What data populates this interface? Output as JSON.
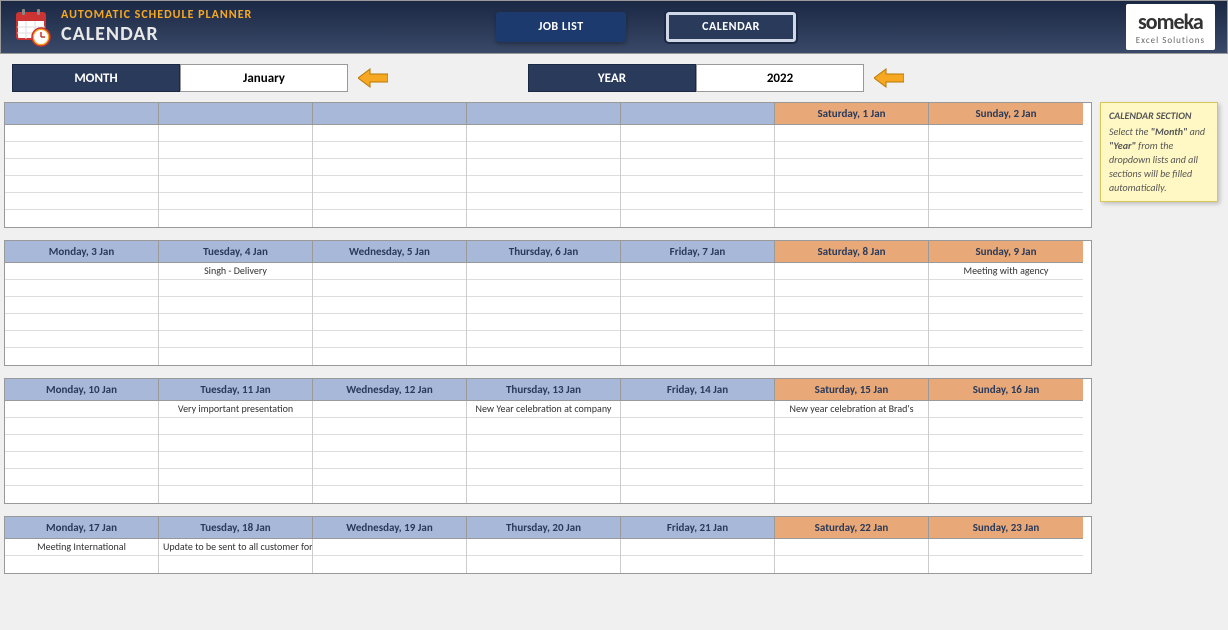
{
  "header": {
    "title_top": "AUTOMATIC SCHEDULE PLANNER",
    "title_main": "CALENDAR",
    "nav_joblist": "JOB LIST",
    "nav_calendar": "CALENDAR",
    "brand_main": "someka",
    "brand_sub": "Excel Solutions"
  },
  "controls": {
    "month_label": "MONTH",
    "month_value": "January",
    "year_label": "YEAR",
    "year_value": "2022"
  },
  "info": {
    "title": "CALENDAR SECTION",
    "text_before_month": "Select the ",
    "month_word": "\"Month\"",
    "text_mid": " and ",
    "year_word": "\"Year\"",
    "text_after": " from the dropdown lists and all sections will be filled automatically."
  },
  "weeks": [
    {
      "days": [
        {
          "label": "",
          "type": "blank",
          "events": [
            "",
            "",
            "",
            "",
            "",
            ""
          ]
        },
        {
          "label": "",
          "type": "blank",
          "events": [
            "",
            "",
            "",
            "",
            "",
            ""
          ]
        },
        {
          "label": "",
          "type": "blank",
          "events": [
            "",
            "",
            "",
            "",
            "",
            ""
          ]
        },
        {
          "label": "",
          "type": "blank",
          "events": [
            "",
            "",
            "",
            "",
            "",
            ""
          ]
        },
        {
          "label": "",
          "type": "blank",
          "events": [
            "",
            "",
            "",
            "",
            "",
            ""
          ]
        },
        {
          "label": "Saturday, 1 Jan",
          "type": "weekend",
          "events": [
            "",
            "",
            "",
            "",
            "",
            ""
          ]
        },
        {
          "label": "Sunday, 2 Jan",
          "type": "weekend",
          "events": [
            "",
            "",
            "",
            "",
            "",
            ""
          ]
        }
      ],
      "rows": 6
    },
    {
      "days": [
        {
          "label": "Monday, 3 Jan",
          "type": "weekday",
          "events": [
            "",
            "",
            "",
            "",
            "",
            ""
          ]
        },
        {
          "label": "Tuesday, 4 Jan",
          "type": "weekday",
          "events": [
            "Singh - Delivery",
            "",
            "",
            "",
            "",
            ""
          ]
        },
        {
          "label": "Wednesday, 5 Jan",
          "type": "weekday",
          "events": [
            "",
            "",
            "",
            "",
            "",
            ""
          ]
        },
        {
          "label": "Thursday, 6 Jan",
          "type": "weekday",
          "events": [
            "",
            "",
            "",
            "",
            "",
            ""
          ]
        },
        {
          "label": "Friday, 7 Jan",
          "type": "weekday",
          "events": [
            "",
            "",
            "",
            "",
            "",
            ""
          ]
        },
        {
          "label": "Saturday, 8 Jan",
          "type": "weekend",
          "events": [
            "",
            "",
            "",
            "",
            "",
            ""
          ]
        },
        {
          "label": "Sunday, 9 Jan",
          "type": "weekend",
          "events": [
            "Meeting with agency",
            "",
            "",
            "",
            "",
            ""
          ]
        }
      ],
      "rows": 6
    },
    {
      "days": [
        {
          "label": "Monday, 10 Jan",
          "type": "weekday",
          "events": [
            "",
            "",
            "",
            "",
            "",
            ""
          ]
        },
        {
          "label": "Tuesday, 11 Jan",
          "type": "weekday",
          "events": [
            "Very important presentation",
            "",
            "",
            "",
            "",
            ""
          ]
        },
        {
          "label": "Wednesday, 12 Jan",
          "type": "weekday",
          "events": [
            "",
            "",
            "",
            "",
            "",
            ""
          ]
        },
        {
          "label": "Thursday, 13 Jan",
          "type": "weekday",
          "events": [
            "New Year celebration at company",
            "",
            "",
            "",
            "",
            ""
          ]
        },
        {
          "label": "Friday, 14 Jan",
          "type": "weekday",
          "events": [
            "",
            "",
            "",
            "",
            "",
            ""
          ]
        },
        {
          "label": "Saturday, 15 Jan",
          "type": "weekend",
          "events": [
            "New year celebration at Brad's",
            "",
            "",
            "",
            "",
            ""
          ]
        },
        {
          "label": "Sunday, 16 Jan",
          "type": "weekend",
          "events": [
            "",
            "",
            "",
            "",
            "",
            ""
          ]
        }
      ],
      "rows": 6
    },
    {
      "days": [
        {
          "label": "Monday, 17 Jan",
          "type": "weekday",
          "events": [
            "Meeting International",
            ""
          ]
        },
        {
          "label": "Tuesday, 18 Jan",
          "type": "weekday",
          "events": [
            "Update to be sent to all customer for th",
            ""
          ]
        },
        {
          "label": "Wednesday, 19 Jan",
          "type": "weekday",
          "events": [
            "",
            ""
          ]
        },
        {
          "label": "Thursday, 20 Jan",
          "type": "weekday",
          "events": [
            "",
            ""
          ]
        },
        {
          "label": "Friday, 21 Jan",
          "type": "weekday",
          "events": [
            "",
            ""
          ]
        },
        {
          "label": "Saturday, 22 Jan",
          "type": "weekend",
          "events": [
            "",
            ""
          ]
        },
        {
          "label": "Sunday, 23 Jan",
          "type": "weekend",
          "events": [
            "",
            ""
          ]
        }
      ],
      "rows": 2
    }
  ]
}
